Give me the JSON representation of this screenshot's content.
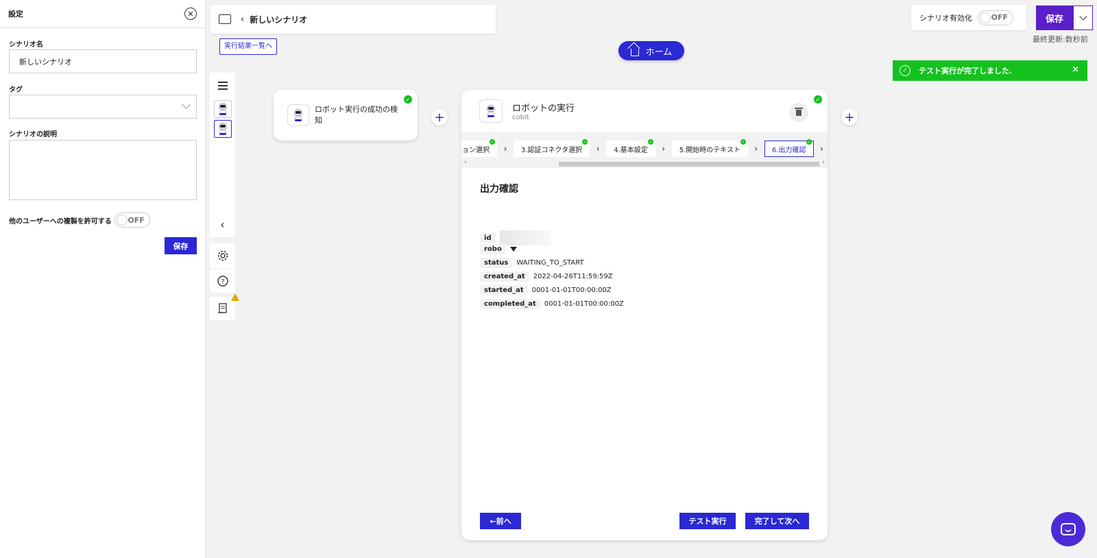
{
  "settings": {
    "title": "設定",
    "scenario_name_label": "シナリオ名",
    "scenario_name_value": "新しいシナリオ",
    "tag_label": "タグ",
    "description_label": "シナリオの説明",
    "allow_copy_label": "他のユーザーへの複製を許可する",
    "allow_copy_toggle": "OFF",
    "save_label": "保存"
  },
  "header": {
    "back_title": "新しいシナリオ",
    "results_link": "実行結果一覧へ",
    "home_label": "ホーム",
    "enable_label": "シナリオ有効化",
    "enable_toggle": "OFF",
    "save_label": "保存",
    "last_updated": "最終更新:数秒前"
  },
  "toast": {
    "message": "テスト実行が完了しました.",
    "close": "×",
    "color": "#14c21e"
  },
  "nodes": {
    "trigger_label": "ロボット実行の成功の検知",
    "action_title": "ロボットの実行",
    "action_sub": "cobit"
  },
  "steps": [
    {
      "label": "ョン選択",
      "active": false
    },
    {
      "label": "3.認証コネクタ選択",
      "active": false
    },
    {
      "label": "4.基本設定",
      "active": false
    },
    {
      "label": "5.開始時のテキスト",
      "active": false
    },
    {
      "label": "6.出力確認",
      "active": true
    }
  ],
  "output": {
    "title": "出力確認",
    "fields": [
      {
        "key": "id",
        "value": ""
      },
      {
        "key": "robo",
        "value": ""
      },
      {
        "key": "status",
        "value": "WAITING_TO_START"
      },
      {
        "key": "created_at",
        "value": "2022-04-26T11:59:59Z"
      },
      {
        "key": "started_at",
        "value": "0001-01-01T00:00:00Z"
      },
      {
        "key": "completed_at",
        "value": "0001-01-01T00:00:00Z"
      }
    ]
  },
  "footer": {
    "prev_label": "←前へ",
    "test_label": "テスト実行",
    "next_label": "完了して次へ"
  },
  "colors": {
    "accent": "#2b28d4",
    "save_purple": "#5a1fc8",
    "success": "#14c21e"
  }
}
